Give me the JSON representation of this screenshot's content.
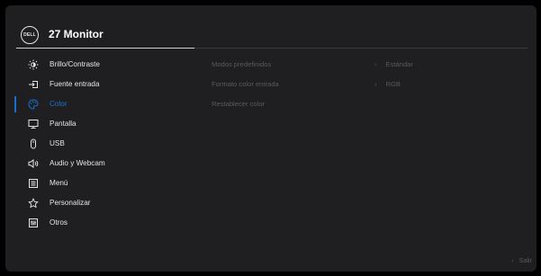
{
  "header": {
    "brand": "DELL",
    "title": "27 Monitor"
  },
  "menu": {
    "items": [
      {
        "label": "Brillo/Contraste",
        "icon": "brightness-icon"
      },
      {
        "label": "Fuente entrada",
        "icon": "input-source-icon"
      },
      {
        "label": "Color",
        "icon": "color-palette-icon",
        "active": true
      },
      {
        "label": "Pantalla",
        "icon": "display-icon"
      },
      {
        "label": "USB",
        "icon": "usb-icon"
      },
      {
        "label": "Audio y Webcam",
        "icon": "speaker-icon"
      },
      {
        "label": "Menú",
        "icon": "menu-list-icon"
      },
      {
        "label": "Personalizar",
        "icon": "star-icon"
      },
      {
        "label": "Otros",
        "icon": "other-settings-icon"
      }
    ]
  },
  "submenu": {
    "items": [
      {
        "label": "Modos predefinidos",
        "value": "Estándar"
      },
      {
        "label": "Formato color entrada",
        "value": "RGB"
      },
      {
        "label": "Restablecer color",
        "value": ""
      }
    ],
    "chevron": "›"
  },
  "footer": {
    "exit_label": "Salir",
    "exit_chevron": "‹"
  },
  "colors": {
    "accent": "#1a6fcc",
    "background": "#1f1f21",
    "text": "#e6e6e6",
    "disabled": "#5a5a5c"
  }
}
